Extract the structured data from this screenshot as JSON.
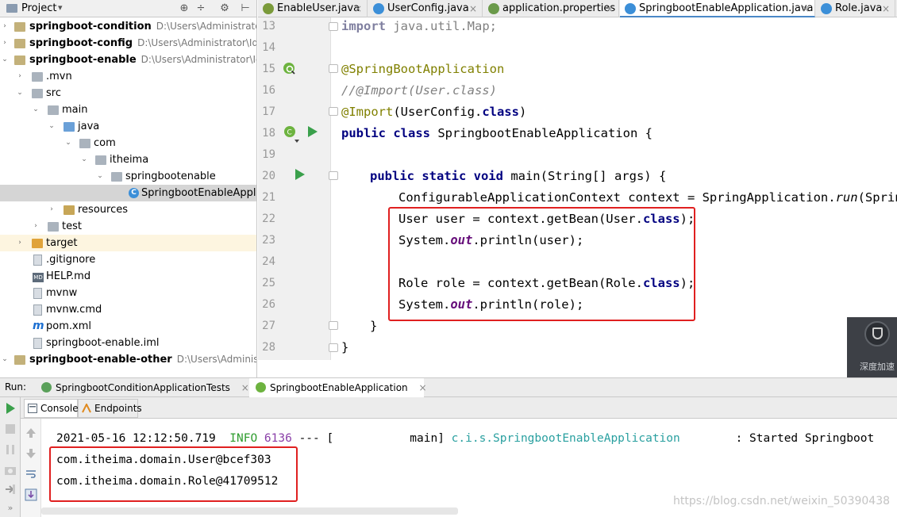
{
  "project": {
    "title": "Project",
    "caret": "▾",
    "toolbar": [
      "⊕",
      "÷",
      "⚙",
      "⊢"
    ],
    "tree": [
      {
        "label": "springboot-condition",
        "path": "D:\\Users\\Administrator\\Id",
        "bold": true,
        "arrow": "›",
        "icon": "folder"
      },
      {
        "label": "springboot-config",
        "path": "D:\\Users\\Administrator\\Idea",
        "bold": true,
        "arrow": "›",
        "icon": "folder"
      },
      {
        "label": "springboot-enable",
        "path": "D:\\Users\\Administrator\\Idea",
        "bold": true,
        "arrow": "⌄",
        "icon": "folder"
      },
      {
        "label": ".mvn",
        "arrow": "›",
        "icon": "folder-plain"
      },
      {
        "label": "src",
        "arrow": "⌄",
        "icon": "folder-plain"
      },
      {
        "label": "main",
        "arrow": "⌄",
        "icon": "folder-plain"
      },
      {
        "label": "java",
        "arrow": "⌄",
        "icon": "folder-src"
      },
      {
        "label": "com",
        "arrow": "⌄",
        "icon": "folder-plain"
      },
      {
        "label": "itheima",
        "arrow": "⌄",
        "icon": "folder-plain"
      },
      {
        "label": "springbootenable",
        "arrow": "⌄",
        "icon": "folder-plain"
      },
      {
        "label": "SpringbootEnableApplication",
        "icon": "class",
        "selected": true
      },
      {
        "label": "resources",
        "arrow": "›",
        "icon": "folder-res"
      },
      {
        "label": "test",
        "arrow": "›",
        "icon": "folder-plain"
      },
      {
        "label": "target",
        "arrow": "›",
        "icon": "folder-target"
      },
      {
        "label": ".gitignore",
        "icon": "file"
      },
      {
        "label": "HELP.md",
        "icon": "md"
      },
      {
        "label": "mvnw",
        "icon": "file"
      },
      {
        "label": "mvnw.cmd",
        "icon": "file"
      },
      {
        "label": "pom.xml",
        "icon": "maven"
      },
      {
        "label": "springboot-enable.iml",
        "icon": "file"
      },
      {
        "label": "springboot-enable-other",
        "path": "D:\\Users\\Administrato",
        "bold": true,
        "arrow": "⌄",
        "icon": "folder"
      }
    ]
  },
  "editor_tabs": [
    {
      "label": "EnableUser.java",
      "icon_color": "#7a9a3a"
    },
    {
      "label": "UserConfig.java",
      "icon_color": "#3c8fd8"
    },
    {
      "label": "application.properties",
      "icon_color": "#6a9a4a"
    },
    {
      "label": "SpringbootEnableApplication.java",
      "icon_color": "#3c8fd8",
      "active": true
    },
    {
      "label": "Role.java",
      "icon_color": "#3c8fd8"
    }
  ],
  "close_glyph": "×",
  "editor": {
    "line_numbers": [
      "13",
      "14",
      "15",
      "16",
      "17",
      "18",
      "19",
      "20",
      "21",
      "22",
      "23",
      "24",
      "25",
      "26",
      "27",
      "28"
    ],
    "code": {
      "l13_kw": "import",
      "l13_rest": " java.util.Map;",
      "l15": "@SpringBootApplication",
      "l16": "//@Import(User.class)",
      "l17_ann": "@Import",
      "l17_a": "(UserConfig.",
      "l17_kw": "class",
      "l17_b": ")",
      "l18_kw": "public class",
      "l18_rest": " SpringbootEnableApplication {",
      "l20_kw": "public static void",
      "l20_rest": " main(String[] args) {",
      "l21_a": "ConfigurableApplicationContext context = SpringApplication.",
      "l21_run": "run",
      "l21_b": "(Springb",
      "l22_a": "User user = context.getBean(User.",
      "l22_kw": "class",
      "l22_b": ");",
      "l23_a": "System.",
      "l23_out": "out",
      "l23_b": ".println(user);",
      "l25_a": "Role role = context.getBean(Role.",
      "l25_kw": "class",
      "l25_b": ");",
      "l26_a": "System.",
      "l26_out": "out",
      "l26_b": ".println(role);",
      "l27": "}",
      "l28": "}"
    }
  },
  "accel_widget": {
    "text": "深度加速"
  },
  "run_panel": {
    "label": "Run:",
    "tabs": [
      {
        "label": "SpringbootConditionApplicationTests"
      },
      {
        "label": "SpringbootEnableApplication",
        "active": true
      }
    ],
    "console_tabs": [
      {
        "label": "Console",
        "active": true
      },
      {
        "label": "Endpoints"
      }
    ],
    "log": {
      "time": "2021-05-16 12:12:50.719",
      "level": "INFO",
      "pid": "6136",
      "sep": "---",
      "thread": "[           main]",
      "logger": "c.i.s.SpringbootEnableApplication",
      "message": ": Started Springboot"
    },
    "output": [
      "com.itheima.domain.User@bcef303",
      "com.itheima.domain.Role@41709512"
    ]
  },
  "watermark": "https://blog.csdn.net/weixin_50390438"
}
